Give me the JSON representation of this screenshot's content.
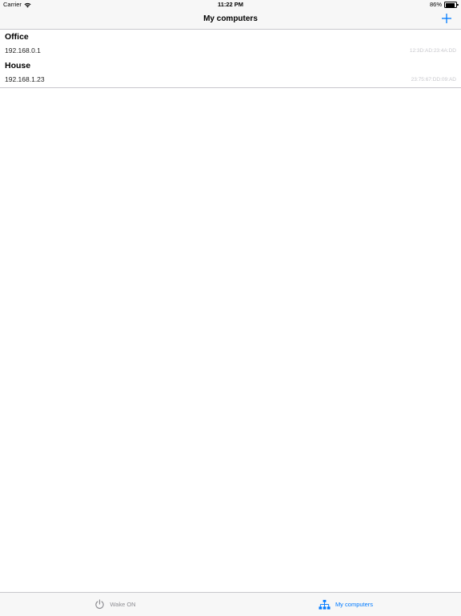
{
  "status_bar": {
    "carrier": "Carrier",
    "time": "11:22 PM",
    "battery": "86%"
  },
  "nav": {
    "title": "My computers",
    "add_icon": "plus-icon"
  },
  "computers": [
    {
      "name": "Office",
      "ip": "192.168.0.1",
      "mac": "12:3D:AD:23:4A:DD"
    },
    {
      "name": "House",
      "ip": "192.168.1.23",
      "mac": "23:75:67:DD:09:AD"
    }
  ],
  "tabs": [
    {
      "label": "Wake ON",
      "icon": "power-icon",
      "selected": false
    },
    {
      "label": "My computers",
      "icon": "network-icon",
      "selected": true
    }
  ],
  "colors": {
    "accent": "#007aff",
    "inactive": "#8e8e93",
    "separator": "#c8c7cc",
    "mac_text": "#c7c7cc"
  }
}
